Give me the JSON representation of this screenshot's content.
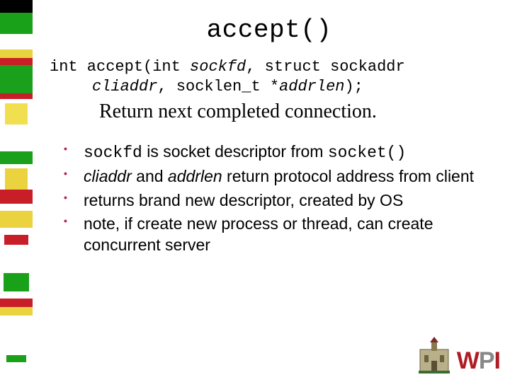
{
  "title": "accept()",
  "signature": {
    "line1_prefix": "int accept(int ",
    "line1_arg1": "sockfd",
    "line1_mid": ", struct sockaddr",
    "line2_arg2": "cliaddr",
    "line2_mid": ", socklen_t *",
    "line2_arg3": "addrlen",
    "line2_suffix": ");"
  },
  "tagline": "Return next completed connection.",
  "bullets": [
    {
      "segments": [
        {
          "text": "sockfd",
          "cls": "mono"
        },
        {
          "text": " is socket descriptor from ",
          "cls": ""
        },
        {
          "text": "socket()",
          "cls": "mono"
        }
      ]
    },
    {
      "segments": [
        {
          "text": "cliaddr",
          "cls": "ital"
        },
        {
          "text": " and ",
          "cls": ""
        },
        {
          "text": "addrlen",
          "cls": "ital"
        },
        {
          "text": " return protocol address from client",
          "cls": ""
        }
      ]
    },
    {
      "segments": [
        {
          "text": "returns brand new descriptor, created by OS",
          "cls": ""
        }
      ]
    },
    {
      "segments": [
        {
          "text": "note, if create new process or thread, can create concurrent server",
          "cls": ""
        }
      ]
    }
  ],
  "logo": {
    "letters": [
      "W",
      "P",
      "I"
    ]
  }
}
